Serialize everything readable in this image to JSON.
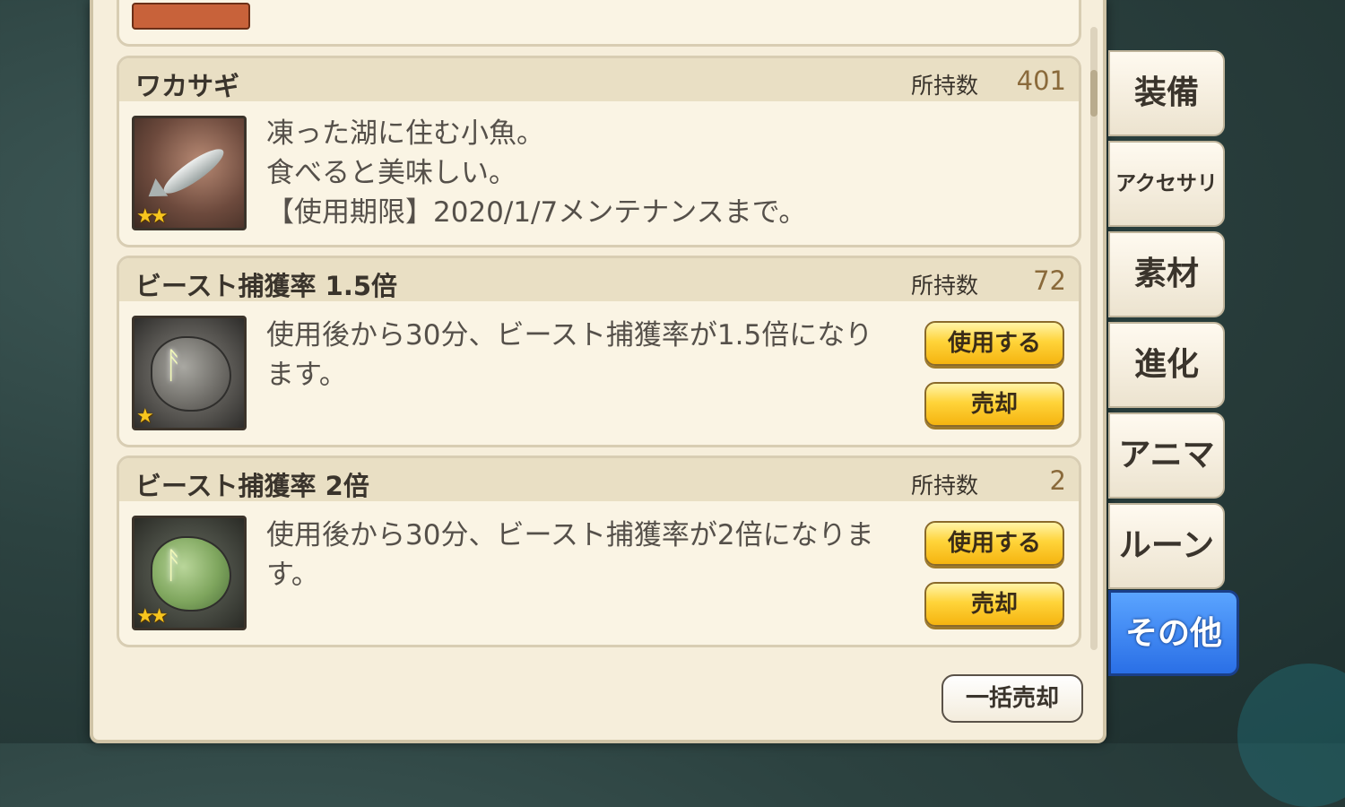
{
  "tabs": [
    {
      "label": "装備",
      "active": false
    },
    {
      "label": "アクセサリ",
      "active": false
    },
    {
      "label": "素材",
      "active": false
    },
    {
      "label": "進化",
      "active": false
    },
    {
      "label": "アニマ",
      "active": false
    },
    {
      "label": "ルーン",
      "active": false
    },
    {
      "label": "その他",
      "active": true
    }
  ],
  "own_label": "所持数",
  "items": [
    {
      "name": "ワカサギ",
      "count": "401",
      "rarity": "★★",
      "icon": "fish-icon",
      "description": [
        "凍った湖に住む小魚。",
        "食べると美味しい。",
        "【使用期限】2020/1/7メンテナンスまで。"
      ],
      "buttons": []
    },
    {
      "name": "ビースト捕獲率 1.5倍",
      "count": "72",
      "rarity": "★",
      "icon": "rune-stone-icon",
      "description": [
        "使用後から30分、ビースト捕獲率が1.5倍になり",
        "ます。"
      ],
      "buttons": {
        "use": "使用する",
        "sell": "売却"
      }
    },
    {
      "name": "ビースト捕獲率 2倍",
      "count": "2",
      "rarity": "★★",
      "icon": "green-rune-stone-icon",
      "description": [
        "使用後から30分、ビースト捕獲率が2倍になりま",
        "す。"
      ],
      "buttons": {
        "use": "使用する",
        "sell": "売却"
      }
    }
  ],
  "bulk_sell_label": "一括売却",
  "colors": {
    "panel": "#f6eedb",
    "active_tab": "#2a6fe6",
    "button_gold": "#ffd43a"
  }
}
